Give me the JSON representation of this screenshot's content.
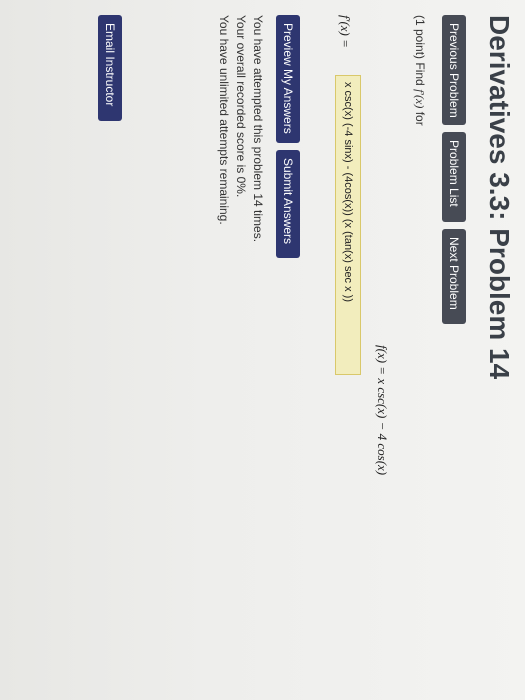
{
  "page": {
    "title": "Derivatives 3.3: Problem 14"
  },
  "nav": {
    "previous": "Previous Problem",
    "list": "Problem List",
    "next": "Next Problem"
  },
  "problem": {
    "points": "(1 point)",
    "find_text": "Find",
    "find_expr": "f′(x)",
    "for_text": "for",
    "given": "f(x) = x csc(x) − 4 cos(x)",
    "answer_label": "f′(x) =",
    "answer_value": "x csc(x) (-4 sinx) - (4cos(x)) (x (tan(x) sec x ))"
  },
  "actions": {
    "preview": "Preview My Answers",
    "submit": "Submit Answers"
  },
  "status": {
    "line1": "You have attempted this problem 14 times.",
    "line2": "Your overall recorded score is 0%.",
    "line3": "You have unlimited attempts remaining."
  },
  "footer": {
    "email": "Email Instructor"
  }
}
